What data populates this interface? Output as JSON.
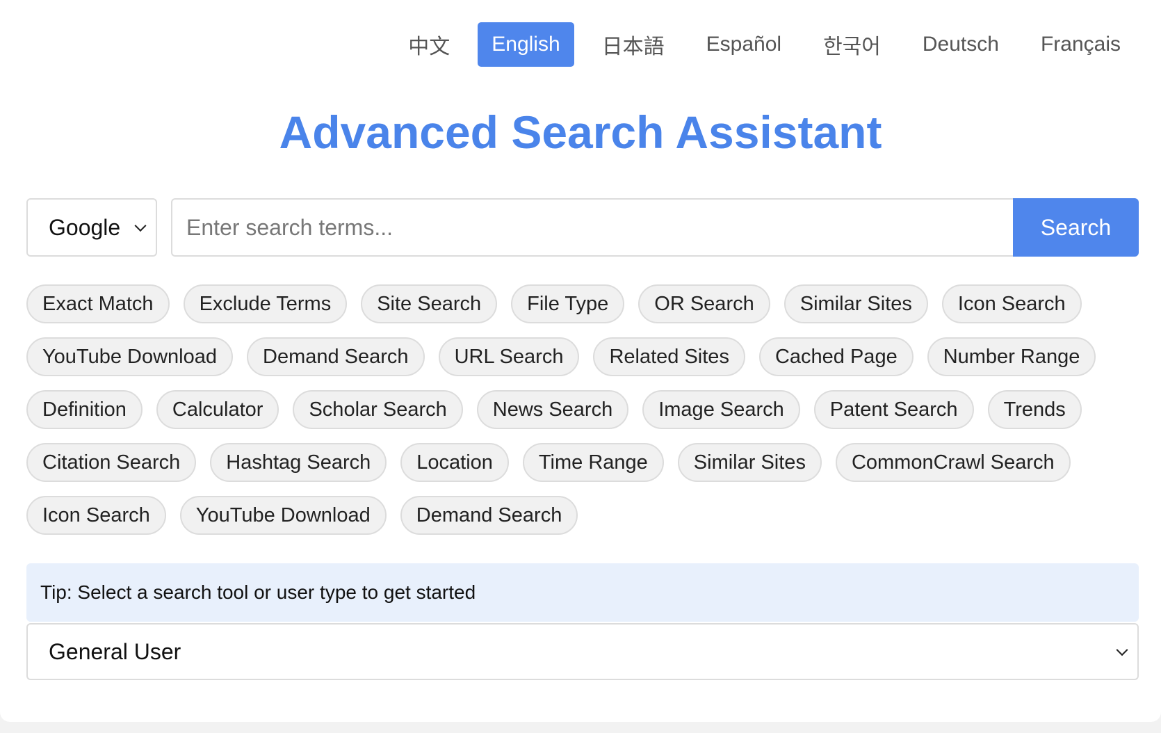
{
  "languages": [
    {
      "label": "中文",
      "active": false
    },
    {
      "label": "English",
      "active": true
    },
    {
      "label": "日本語",
      "active": false
    },
    {
      "label": "Español",
      "active": false
    },
    {
      "label": "한국어",
      "active": false
    },
    {
      "label": "Deutsch",
      "active": false
    },
    {
      "label": "Français",
      "active": false
    }
  ],
  "title": "Advanced Search Assistant",
  "search": {
    "engine": "Google",
    "placeholder": "Enter search terms...",
    "value": "",
    "button_label": "Search"
  },
  "tools": [
    "Exact Match",
    "Exclude Terms",
    "Site Search",
    "File Type",
    "OR Search",
    "Similar Sites",
    "Icon Search",
    "YouTube Download",
    "Demand Search",
    "URL Search",
    "Related Sites",
    "Cached Page",
    "Number Range",
    "Definition",
    "Calculator",
    "Scholar Search",
    "News Search",
    "Image Search",
    "Patent Search",
    "Trends",
    "Citation Search",
    "Hashtag Search",
    "Location",
    "Time Range",
    "Similar Sites",
    "CommonCrawl Search",
    "Icon Search",
    "YouTube Download",
    "Demand Search"
  ],
  "tip": "Tip: Select a search tool or user type to get started",
  "user_type": {
    "selected": "General User"
  },
  "colors": {
    "accent": "#4f86ec",
    "title": "#4a84ea",
    "tip_background": "#e8f0fc",
    "chip_background": "#f1f1f1"
  }
}
